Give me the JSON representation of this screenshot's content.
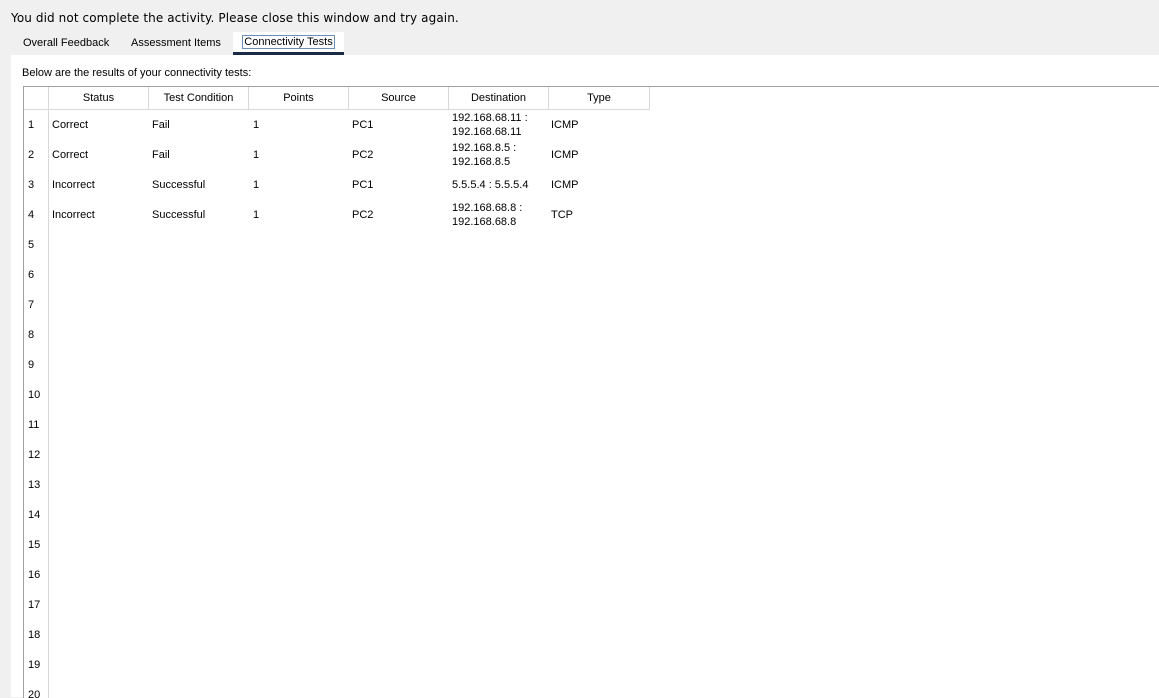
{
  "message": "You did not complete the activity. Please close this window and try again.",
  "tabs": [
    {
      "label": "Overall Feedback",
      "active": false
    },
    {
      "label": "Assessment Items",
      "active": false
    },
    {
      "label": "Connectivity Tests",
      "active": true
    }
  ],
  "intro": "Below are the results of your connectivity tests:",
  "table": {
    "columns": [
      "Status",
      "Test Condition",
      "Points",
      "Source",
      "Destination",
      "Type"
    ],
    "rows": [
      {
        "num": "1",
        "status": "Correct",
        "condition": "Fail",
        "points": "1",
        "source": "PC1",
        "destination_line1": "192.168.68.11 :",
        "destination_line2": "192.168.68.11",
        "type": "ICMP"
      },
      {
        "num": "2",
        "status": "Correct",
        "condition": "Fail",
        "points": "1",
        "source": "PC2",
        "destination_line1": "192.168.8.5 :",
        "destination_line2": "192.168.8.5",
        "type": "ICMP"
      },
      {
        "num": "3",
        "status": "Incorrect",
        "condition": "Successful",
        "points": "1",
        "source": "PC1",
        "destination_line1": "5.5.5.4 : 5.5.5.4",
        "destination_line2": "",
        "type": "ICMP"
      },
      {
        "num": "4",
        "status": "Incorrect",
        "condition": "Successful",
        "points": "1",
        "source": "PC2",
        "destination_line1": "192.168.68.8 :",
        "destination_line2": "192.168.68.8",
        "type": "TCP"
      }
    ],
    "empty_row_numbers": [
      "5",
      "6",
      "7",
      "8",
      "9",
      "10",
      "11",
      "12",
      "13",
      "14",
      "15",
      "16",
      "17",
      "18",
      "19",
      "20"
    ]
  }
}
